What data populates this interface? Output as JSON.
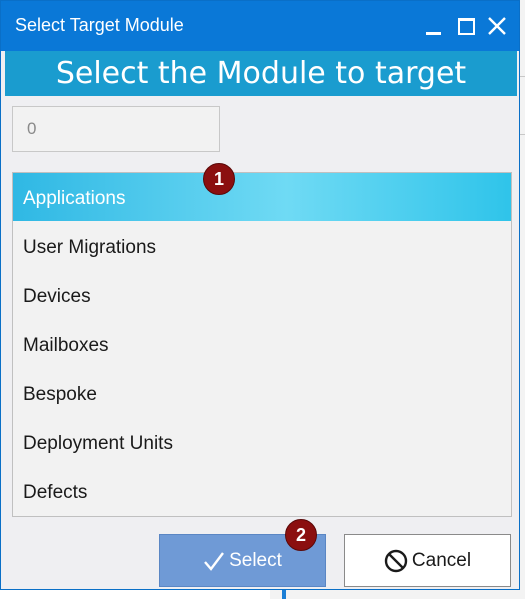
{
  "window": {
    "title": "Select Target Module",
    "buttons": {
      "minimize": "minimize-icon",
      "maximize": "maximize-icon",
      "close": "close-icon"
    }
  },
  "header": {
    "text": "Select the Module to target"
  },
  "filter": {
    "value": "0"
  },
  "modules": {
    "selected_index": 0,
    "items": [
      {
        "label": "Applications"
      },
      {
        "label": "User Migrations"
      },
      {
        "label": "Devices"
      },
      {
        "label": "Mailboxes"
      },
      {
        "label": "Bespoke"
      },
      {
        "label": "Deployment Units"
      },
      {
        "label": "Defects"
      }
    ]
  },
  "markers": {
    "m1": "1",
    "m2": "2"
  },
  "actions": {
    "select_label": "Select",
    "select_icon": "checkmark-icon",
    "cancel_label": "Cancel",
    "cancel_icon": "prohibited-icon"
  },
  "colors": {
    "titlebar": "#0a78d7",
    "header": "#1a9ccf",
    "selection": "#4fcdee",
    "select_button": "#6f9ad6",
    "marker": "#8b0f0f"
  }
}
